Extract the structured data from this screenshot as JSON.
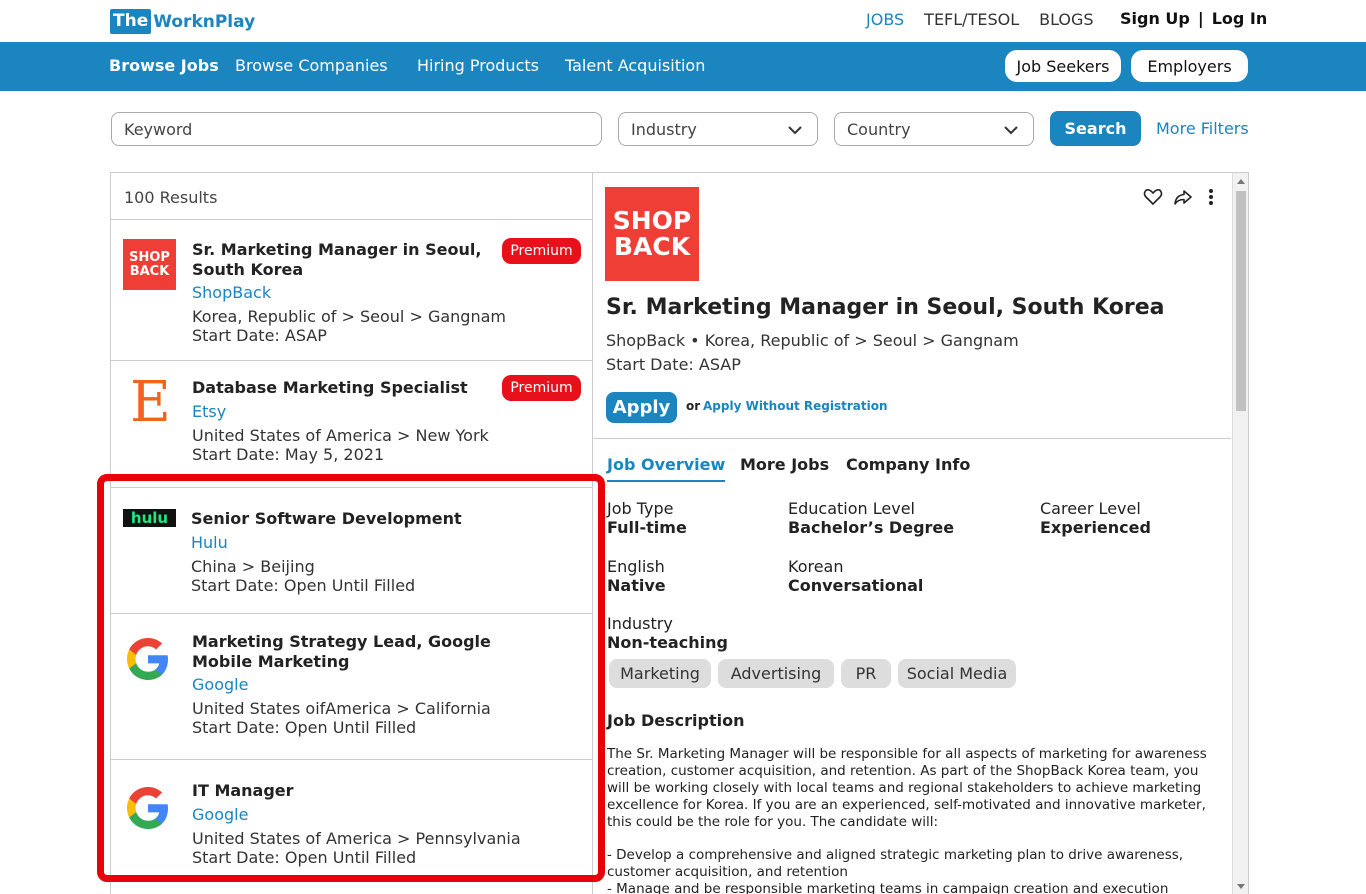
{
  "site": {
    "logo_the": "The",
    "logo_rest": "WorknPlay",
    "topnav": [
      "JOBS",
      "TEFL/TESOL",
      "BLOGS"
    ],
    "sign_up": "Sign Up",
    "auth_sep": "|",
    "log_in": "Log In"
  },
  "nav": {
    "items": [
      "Browse Jobs",
      "Browse Companies",
      "Hiring Products",
      "Talent Acquisition"
    ],
    "job_seekers": "Job Seekers",
    "employers": "Employers"
  },
  "search": {
    "keyword_placeholder": "Keyword",
    "industry": "Industry",
    "country": "Country",
    "button": "Search",
    "more_filters": "More Filters"
  },
  "results": {
    "count": "100 Results",
    "jobs": [
      {
        "title": "Sr. Marketing Manager in Seoul, South Korea",
        "company": "ShopBack",
        "location": "Korea, Republic of > Seoul > Gangnam",
        "start": "Start Date: ASAP",
        "badge": "Premium",
        "logo": "shopback-logo"
      },
      {
        "title": "Database Marketing Specialist",
        "company": "Etsy",
        "location": "United States of America > New York",
        "start": "Start Date: May 5, 2021",
        "badge": "Premium",
        "logo": "etsy-logo"
      },
      {
        "title": "Senior Software Development",
        "company": "Hulu",
        "location": "China > Beijing",
        "start": "Start Date: Open Until Filled",
        "badge": "",
        "logo": "hulu-logo"
      },
      {
        "title": "Marketing Strategy Lead, Google Mobile Marketing",
        "company": "Google",
        "location": "United States oifAmerica > California",
        "start": "Start Date: Open Until Filled",
        "badge": "",
        "logo": "google-logo"
      },
      {
        "title": "IT Manager",
        "company": "Google",
        "location": "United States of America > Pennsylvania",
        "start": "Start Date: Open Until Filled",
        "badge": "",
        "logo": "google-logo"
      }
    ]
  },
  "logos": {
    "shopback_line1": "SHOP",
    "shopback_line2": "BACK",
    "etsy": "E",
    "hulu": "hulu"
  },
  "detail": {
    "title": "Sr. Marketing Manager in Seoul, South Korea",
    "subtitle": "ShopBack • Korea, Republic of > Seoul > Gangnam",
    "start": "Start Date: ASAP",
    "apply": "Apply",
    "or": "or",
    "apply_without": "Apply Without Registration",
    "tabs": [
      "Job Overview",
      "More Jobs",
      "Company Info"
    ],
    "attributes": [
      {
        "label": "Job Type",
        "value": "Full-time"
      },
      {
        "label": "Education Level",
        "value": "Bachelor’s Degree"
      },
      {
        "label": "Career Level",
        "value": "Experienced"
      },
      {
        "label": "English",
        "value": "Native"
      },
      {
        "label": "Korean",
        "value": "Conversational"
      },
      {
        "label": "Industry",
        "value": "Non-teaching"
      }
    ],
    "tags": [
      "Marketing",
      "Advertising",
      "PR",
      "Social Media"
    ],
    "description_heading": "Job Description",
    "description": "The Sr. Marketing Manager will be responsible for all aspects of marketing for awareness creation, customer acquisition, and retention. As part of the ShopBack Korea team, you will be working closely with local teams and regional stakeholders to achieve marketing excellence for Korea. If you are an experienced, self-motivated and innovative marketer, this could be the role for you. The candidate will:",
    "bullet_1": "- Develop a comprehensive and aligned strategic marketing plan to drive awareness, customer acquisition, and retention",
    "bullet_2": "- Manage and be responsible marketing teams in campaign creation and execution"
  },
  "colors": {
    "brand_blue": "#1a85be",
    "premium_red": "#e8111b",
    "highlight_red": "#e8000b",
    "shopback_red": "#ee3e36",
    "etsy_orange": "#f1641e",
    "hulu_green": "#1ce783"
  }
}
